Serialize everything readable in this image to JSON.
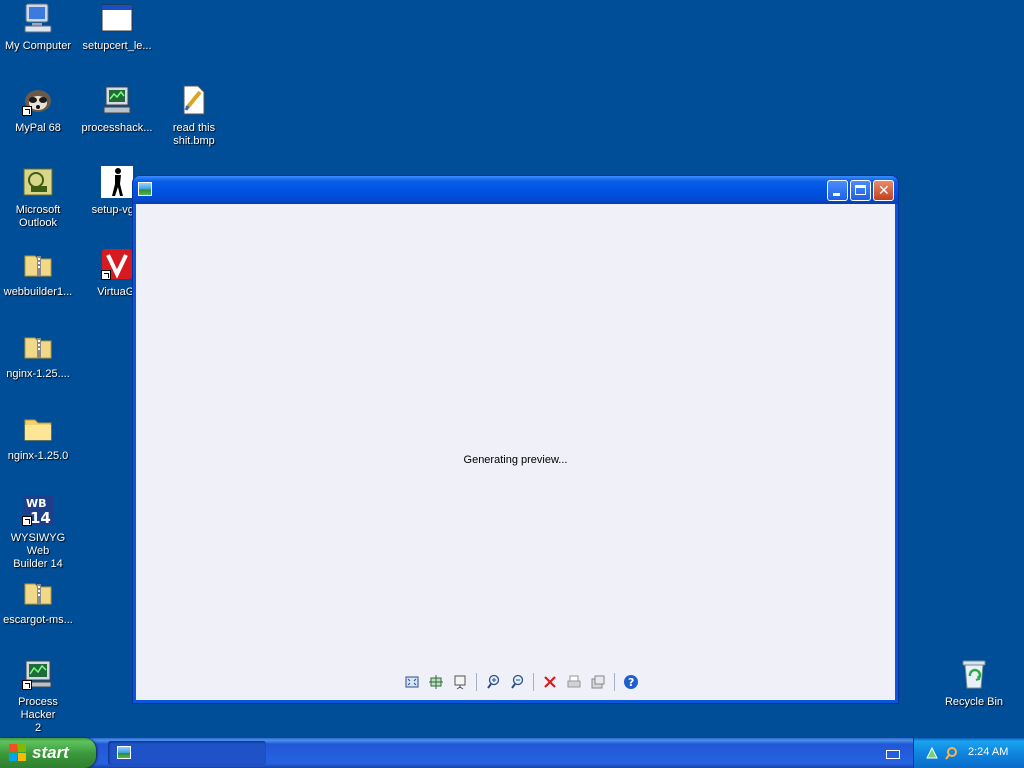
{
  "desktop": {
    "icons": [
      {
        "label": "My Computer",
        "icon": "my-computer-icon"
      },
      {
        "label": "setupcert_le...",
        "icon": "window-app-icon"
      },
      {
        "label": "MyPal 68",
        "icon": "raccoon-icon"
      },
      {
        "label": "processhack...",
        "icon": "monitor-app-icon"
      },
      {
        "label": "read this\nshit.bmp",
        "icon": "bitmap-file-icon"
      },
      {
        "label": "Microsoft\nOutlook",
        "icon": "outlook-icon"
      },
      {
        "label": "setup-vgirl",
        "icon": "silhouette-icon"
      },
      {
        "label": "webbuilder1...",
        "icon": "zip-folder-icon"
      },
      {
        "label": "VirtuaGi",
        "icon": "virtuagirl-icon"
      },
      {
        "label": "nginx-1.25....",
        "icon": "zip-folder-icon"
      },
      {
        "label": "nginx-1.25.0",
        "icon": "folder-icon"
      },
      {
        "label": "WYSIWYG Web\nBuilder 14",
        "icon": "wb14-icon"
      },
      {
        "label": "escargot-ms...",
        "icon": "zip-folder-icon"
      },
      {
        "label": "Process Hacker\n2",
        "icon": "process-hacker-icon"
      },
      {
        "label": "Recycle Bin",
        "icon": "recycle-bin-icon"
      }
    ]
  },
  "window": {
    "title": "",
    "message": "Generating preview...",
    "toolbar": [
      "best-fit-icon",
      "actual-size-icon",
      "slideshow-icon",
      "zoom-in-icon",
      "zoom-out-icon",
      "delete-icon",
      "print-icon",
      "copy-to-icon",
      "help-icon"
    ]
  },
  "taskbar": {
    "start_label": "start",
    "task_label": "",
    "clock": "2:24 AM"
  }
}
